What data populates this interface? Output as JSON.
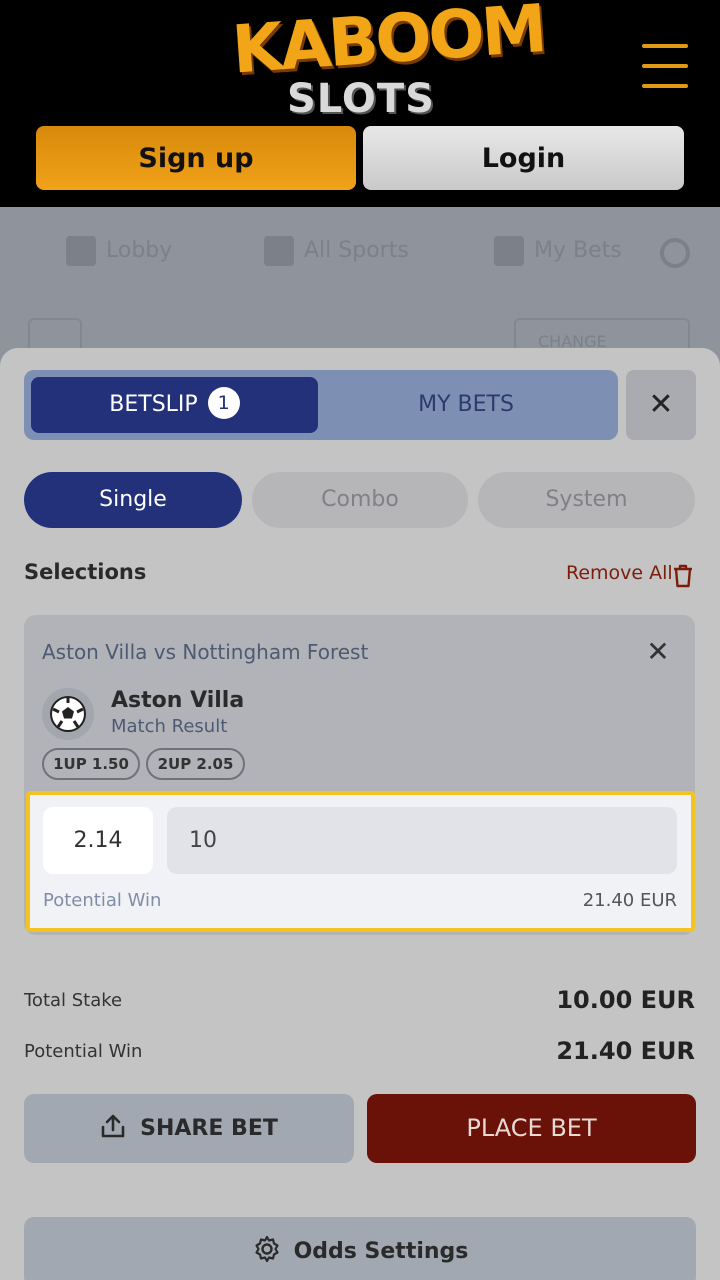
{
  "header": {
    "logo_top": "KABOOM",
    "logo_bottom": "SLOTS",
    "signup_label": "Sign up",
    "login_label": "Login"
  },
  "background_nav": {
    "lobby": "Lobby",
    "all_sports": "All Sports",
    "my_bets": "My Bets",
    "change": "CHANGE"
  },
  "betslip": {
    "tab_betslip": "BETSLIP",
    "betslip_count": "1",
    "tab_mybets": "MY BETS",
    "close": "✕",
    "types": [
      "Single",
      "Combo",
      "System"
    ],
    "selections_label": "Selections",
    "remove_all": "Remove All"
  },
  "selection": {
    "match": "Aston Villa vs Nottingham Forest",
    "close": "✕",
    "team": "Aston Villa",
    "market": "Match Result",
    "chips": [
      "1UP 1.50",
      "2UP 2.05"
    ],
    "odds": "2.14",
    "stake": "10",
    "potential_win_label": "Potential Win",
    "potential_win_value": "21.40 EUR"
  },
  "summary": {
    "total_stake_label": "Total Stake",
    "total_stake_value": "10.00 EUR",
    "potential_win_label": "Potential Win",
    "potential_win_value": "21.40 EUR"
  },
  "actions": {
    "share_label": "SHARE BET",
    "place_label": "PLACE BET",
    "odds_settings_label": "Odds Settings"
  },
  "colors": {
    "accent_blue": "#23307a",
    "brand_orange": "#f1a21a",
    "place_bet": "#6a1108",
    "highlight": "#f3c322"
  }
}
